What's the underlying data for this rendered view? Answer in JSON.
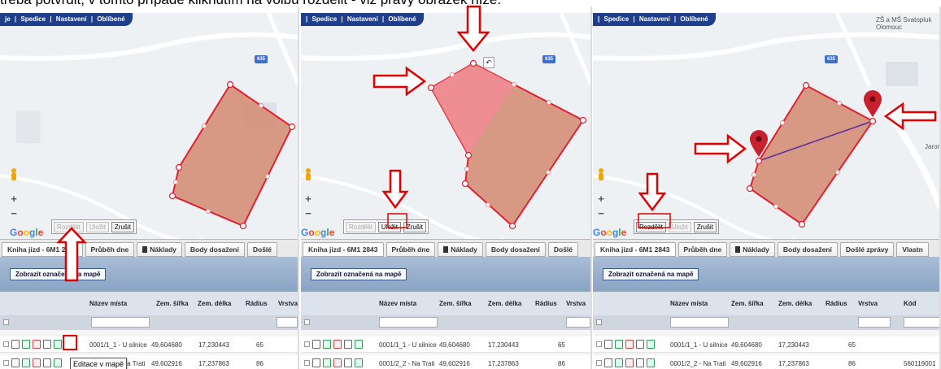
{
  "intro_text": "třeba potvrdit, v tomto případě kliknutím na volbu rozdělit - viz pravý obrázek níže.",
  "menu": {
    "items": [
      "je",
      "Spedice",
      "Nastavení",
      "Oblíbené"
    ],
    "sep": "|"
  },
  "map": {
    "road_label": "635",
    "city_line1": "ZŠ a MŠ Svatopluk",
    "city_line2": "Olomouc",
    "street_label": "Jarom",
    "zoom_in": "+",
    "zoom_out": "−",
    "undo_icon": "↶",
    "google": [
      "G",
      "o",
      "o",
      "g",
      "l",
      "e"
    ]
  },
  "buttons": {
    "split": "Rozdělit",
    "save": "Uložit",
    "cancel": "Zrušit"
  },
  "tabs": {
    "p1": [
      "Kniha jízd - 6M1 2843",
      "Průběh dne",
      "Náklady",
      "Body dosažení",
      "Došlé"
    ],
    "p2": [
      "Kniha jízd - 6M1 2843",
      "Průběh dne",
      "Náklady",
      "Body dosažení",
      "Došlé"
    ],
    "p3": [
      "Kniha jízd - 6M1 2843",
      "Průběh dne",
      "Náklady",
      "Body dosažení",
      "Došlé zprávy",
      "Vlastn"
    ]
  },
  "grid": {
    "show_button": "Zobrazit označená na mapě",
    "headers": {
      "name": "Název místa",
      "lat": "Zem. šířka",
      "lon": "Zem. délka",
      "radius": "Rádius",
      "layer": "Vrstva",
      "code": "Kód"
    },
    "rows": [
      {
        "name": "0001/1_1 - U silnice",
        "lat": "49,604680",
        "lon": "17,230443",
        "radius": "65",
        "code": ""
      },
      {
        "name": "0001/2_2 - Na Trati",
        "lat": "49,602916",
        "lon": "17,237863",
        "radius": "86",
        "code": "560119001"
      }
    ],
    "tooltip": "Editace v mapě"
  },
  "colors": {
    "menubar": "#1f3f8a",
    "polygon_fill": "#d48a70",
    "polygon_stroke": "#e02030",
    "preview_fill": "#f28c95",
    "arrow": "#e00000",
    "split_line": "#5b2d9a"
  }
}
